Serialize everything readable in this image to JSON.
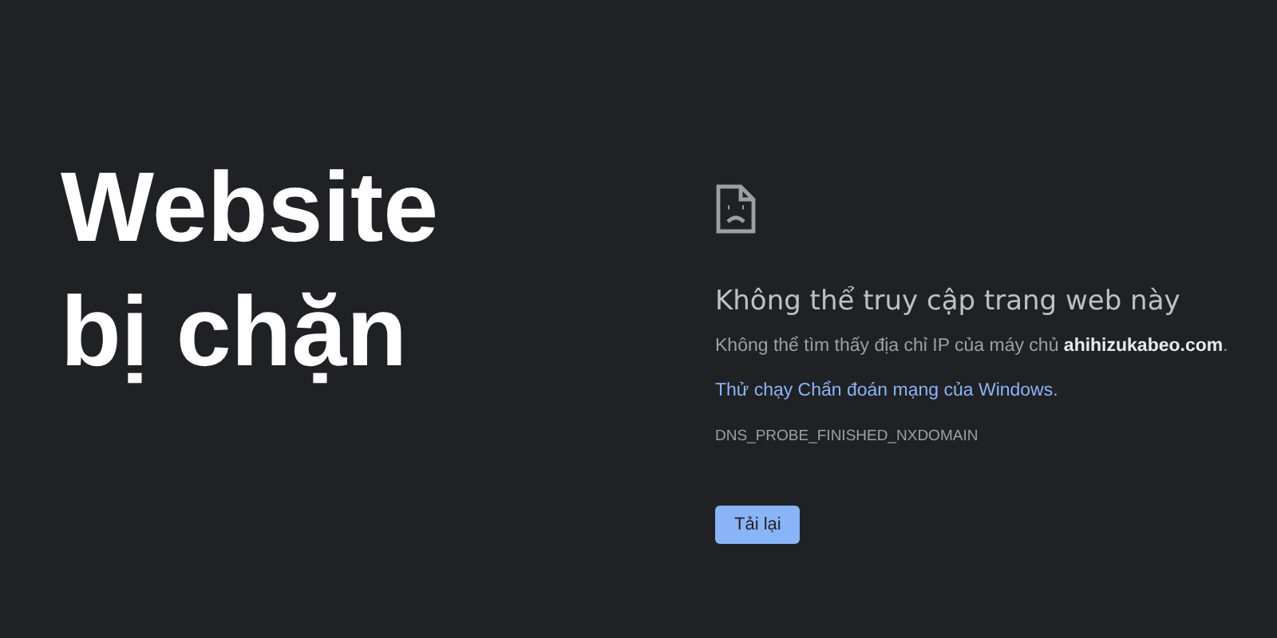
{
  "headline": {
    "lines": [
      "Website",
      "bị chặn"
    ]
  },
  "error": {
    "title": "Không thể truy cập trang web này",
    "message": "Không thể tìm thấy địa chỉ IP của máy chủ **ahihizukabeo.com**.",
    "link": "Thử chạy Chẩn đoán mạng của Windows.",
    "code": "DNS_PROBE_FINISHED_NXDOMAIN",
    "reload_button": "Tải lại"
  }
}
